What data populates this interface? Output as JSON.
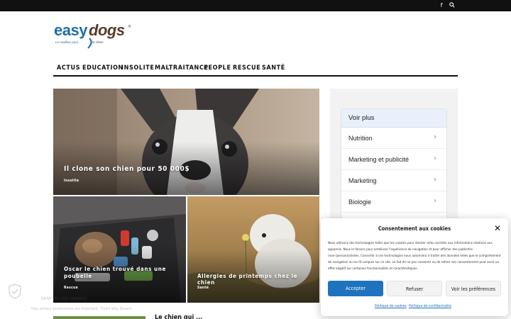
{
  "topbar": {
    "icons": [
      {
        "name": "facebook-icon",
        "glyph": "f"
      },
      {
        "name": "search-icon",
        "glyph": "⚲"
      }
    ]
  },
  "logo": {
    "text_easy": "easy",
    "text_dogs": "dogs",
    "tagline": "Le meilleur pour le chien",
    "mark": "®",
    "colors": {
      "easy": "#1e6fa8",
      "dogs": "#5a3b2b"
    }
  },
  "nav": {
    "items": [
      "ACTUS",
      "EDUCATION",
      "INSOLITE",
      "MALTRAITANCE",
      "PEOPLE",
      "RESCUE",
      "SANTÉ"
    ]
  },
  "featured": {
    "main": {
      "title": "Il clone son chien pour 50 000$",
      "category": "Insolite"
    },
    "left": {
      "title": "Oscar le chien trouvé dans une poubelle",
      "category": "Rescue"
    },
    "right": {
      "title": "Allergies de printemps chez le chien",
      "category": "Santé"
    }
  },
  "sidebar": {
    "heading": "Voir plus",
    "items": [
      "Nutrition",
      "Marketing et publicité",
      "Marketing",
      "Biologie"
    ],
    "chevron": "›"
  },
  "privacy_ghost": {
    "title": "How we use cookies",
    "text": "Your privacy preferences are important. That's why. Based"
  },
  "bottom": {
    "title": "Le chien qui ..."
  },
  "cookie": {
    "title": "Consentement aux cookies",
    "close": "✕",
    "body": "Nous utilisons des technologies telles que les cookies pour stocker et/ou accéder aux informations relatives aux appareils. Nous le faisons pour améliorer l'expérience de navigation et pour afficher des publicités (non-)personnalisées. Consentir à ces technologies nous autorisera à traiter des données telles que le comportement de navigation ou les ID uniques sur ce site. Le fait de ne pas consentir ou de retirer son consentement peut avoir un effet négatif sur certaines fonctionnalités et caractéristiques.",
    "accept": "Accepter",
    "refuse": "Refuser",
    "prefs": "Voir les préférences",
    "link_cookies": "Politique de cookies",
    "link_privacy": "Politique de confidentialité",
    "accent": "#1e73be"
  }
}
